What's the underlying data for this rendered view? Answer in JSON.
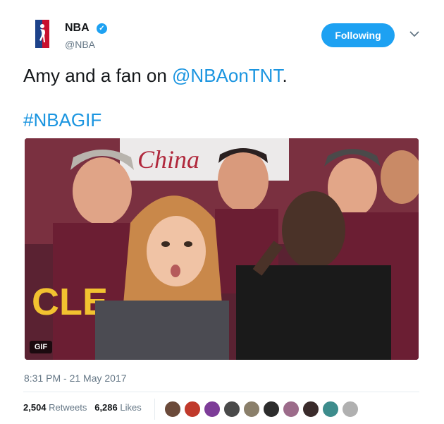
{
  "account": {
    "name": "NBA",
    "handle": "@NBA",
    "follow_label": "Following"
  },
  "tweet": {
    "text_before": "Amy and a fan on ",
    "mention": "@NBAonTNT",
    "text_after": ".",
    "hashtag": "#NBAGIF",
    "media_badge": "GIF",
    "media_sign_text": "China",
    "shirt_text": "CLE",
    "timestamp": "8:31 PM - 21 May 2017"
  },
  "stats": {
    "retweets_count": "2,504",
    "retweets_label": "Retweets",
    "likes_count": "6,286",
    "likes_label": "Likes"
  },
  "likers": [
    "#6b4a3a",
    "#c0392b",
    "#7d3c98",
    "#4a4a4a",
    "#8a7f6a",
    "#2c2c2c",
    "#9c6b8a",
    "#3a2b2b",
    "#3d8c8c",
    "#b0b0b0"
  ],
  "colors": {
    "accent": "#1da1f2",
    "link": "#1b95e0",
    "muted": "#657786"
  }
}
